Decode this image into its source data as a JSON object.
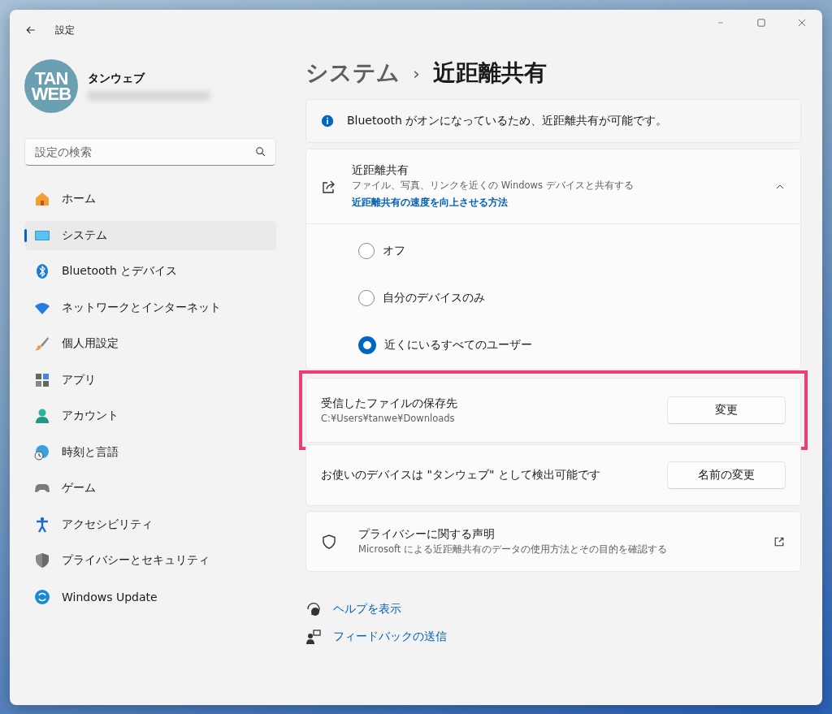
{
  "window": {
    "title": "設定"
  },
  "profile": {
    "logo_lines": [
      "TAN",
      "WEB"
    ],
    "name": "タンウェブ"
  },
  "search": {
    "placeholder": "設定の検索"
  },
  "sidebar": {
    "items": [
      {
        "label": "ホーム",
        "kind": "home",
        "selected": false
      },
      {
        "label": "システム",
        "kind": "system",
        "selected": true
      },
      {
        "label": "Bluetooth とデバイス",
        "kind": "bluetooth",
        "selected": false
      },
      {
        "label": "ネットワークとインターネット",
        "kind": "network",
        "selected": false
      },
      {
        "label": "個人用設定",
        "kind": "brush",
        "selected": false
      },
      {
        "label": "アプリ",
        "kind": "apps",
        "selected": false
      },
      {
        "label": "アカウント",
        "kind": "account",
        "selected": false
      },
      {
        "label": "時刻と言語",
        "kind": "time",
        "selected": false
      },
      {
        "label": "ゲーム",
        "kind": "gamepad",
        "selected": false
      },
      {
        "label": "アクセシビリティ",
        "kind": "accessibility",
        "selected": false
      },
      {
        "label": "プライバシーとセキュリティ",
        "kind": "shield",
        "selected": false
      },
      {
        "label": "Windows Update",
        "kind": "update",
        "selected": false
      }
    ]
  },
  "breadcrumb": {
    "parent": "システム",
    "separator": "›",
    "current": "近距離共有"
  },
  "info_banner": {
    "text": "Bluetooth がオンになっているため、近距離共有が可能です。"
  },
  "sharing": {
    "title": "近距離共有",
    "description": "ファイル、写真、リンクを近くの Windows デバイスと共有する",
    "link": "近距離共有の速度を向上させる方法",
    "expanded": true,
    "options": [
      {
        "label": "オフ",
        "selected": false
      },
      {
        "label": "自分のデバイスのみ",
        "selected": false
      },
      {
        "label": "近くにいるすべてのユーザー",
        "selected": true
      }
    ]
  },
  "rows": [
    {
      "title": "受信したファイルの保存先",
      "subtitle": "C:¥Users¥tanwe¥Downloads",
      "button": "変更",
      "highlighted": true
    },
    {
      "title": "お使いのデバイスは \"タンウェブ\" として検出可能です",
      "button": "名前の変更",
      "highlighted": false
    }
  ],
  "privacy": {
    "title": "プライバシーに関する声明",
    "description": "Microsoft による近距離共有のデータの使用方法とその目的を確認する"
  },
  "help_links": [
    {
      "label": "ヘルプを表示",
      "kind": "help"
    },
    {
      "label": "フィードバックの送信",
      "kind": "feedback"
    }
  ]
}
